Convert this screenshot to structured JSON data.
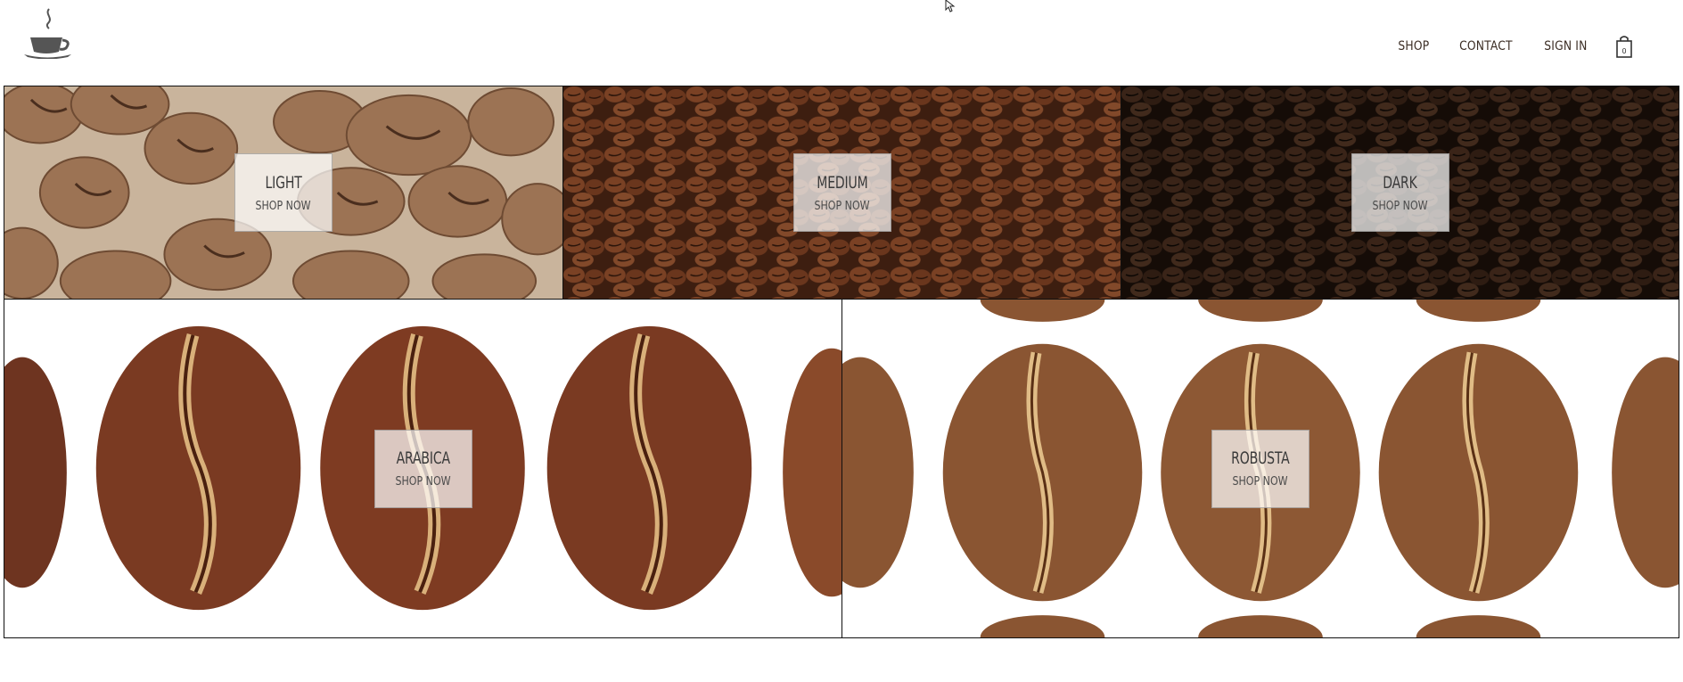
{
  "header": {
    "logo": "coffee-cup-logo",
    "nav": [
      {
        "label": "SHOP"
      },
      {
        "label": "CONTACT"
      },
      {
        "label": "SIGN IN"
      }
    ],
    "cart": {
      "count": "0",
      "icon": "shopping-bag-icon"
    }
  },
  "tiles": {
    "light": {
      "title": "LIGHT",
      "cta": "SHOP NOW"
    },
    "medium": {
      "title": "MEDIUM",
      "cta": "SHOP NOW"
    },
    "dark": {
      "title": "DARK",
      "cta": "SHOP NOW"
    },
    "arabica": {
      "title": "ARABICA",
      "cta": "SHOP NOW"
    },
    "robusta": {
      "title": "ROBUSTA",
      "cta": "SHOP NOW"
    }
  },
  "colors": {
    "light_roast": "#a57a58",
    "medium_roast": "#6b3a1f",
    "dark_roast": "#2a1a12",
    "arabica_bean": "#7a3a22",
    "robusta_bean": "#8a5532",
    "nav_text": "#3c2e25"
  }
}
